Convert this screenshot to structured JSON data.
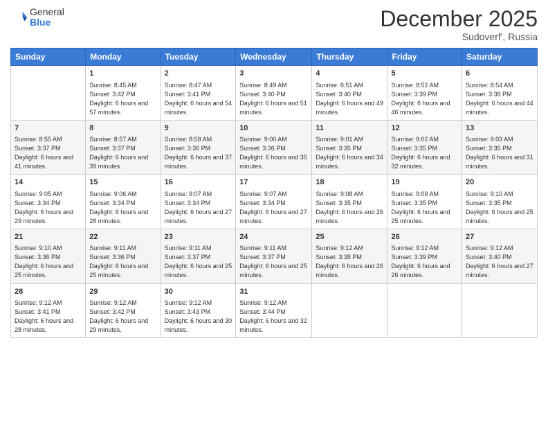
{
  "header": {
    "logo_general": "General",
    "logo_blue": "Blue",
    "month": "December 2025",
    "location": "Sudoverf', Russia"
  },
  "days_of_week": [
    "Sunday",
    "Monday",
    "Tuesday",
    "Wednesday",
    "Thursday",
    "Friday",
    "Saturday"
  ],
  "weeks": [
    [
      {
        "day": "",
        "empty": true
      },
      {
        "day": "1",
        "sunrise": "Sunrise: 8:45 AM",
        "sunset": "Sunset: 3:42 PM",
        "daylight": "Daylight: 6 hours and 57 minutes."
      },
      {
        "day": "2",
        "sunrise": "Sunrise: 8:47 AM",
        "sunset": "Sunset: 3:41 PM",
        "daylight": "Daylight: 6 hours and 54 minutes."
      },
      {
        "day": "3",
        "sunrise": "Sunrise: 8:49 AM",
        "sunset": "Sunset: 3:40 PM",
        "daylight": "Daylight: 6 hours and 51 minutes."
      },
      {
        "day": "4",
        "sunrise": "Sunrise: 8:51 AM",
        "sunset": "Sunset: 3:40 PM",
        "daylight": "Daylight: 6 hours and 49 minutes."
      },
      {
        "day": "5",
        "sunrise": "Sunrise: 8:52 AM",
        "sunset": "Sunset: 3:39 PM",
        "daylight": "Daylight: 6 hours and 46 minutes."
      },
      {
        "day": "6",
        "sunrise": "Sunrise: 8:54 AM",
        "sunset": "Sunset: 3:38 PM",
        "daylight": "Daylight: 6 hours and 44 minutes."
      }
    ],
    [
      {
        "day": "7",
        "sunrise": "Sunrise: 8:55 AM",
        "sunset": "Sunset: 3:37 PM",
        "daylight": "Daylight: 6 hours and 41 minutes."
      },
      {
        "day": "8",
        "sunrise": "Sunrise: 8:57 AM",
        "sunset": "Sunset: 3:37 PM",
        "daylight": "Daylight: 6 hours and 39 minutes."
      },
      {
        "day": "9",
        "sunrise": "Sunrise: 8:58 AM",
        "sunset": "Sunset: 3:36 PM",
        "daylight": "Daylight: 6 hours and 37 minutes."
      },
      {
        "day": "10",
        "sunrise": "Sunrise: 9:00 AM",
        "sunset": "Sunset: 3:36 PM",
        "daylight": "Daylight: 6 hours and 35 minutes."
      },
      {
        "day": "11",
        "sunrise": "Sunrise: 9:01 AM",
        "sunset": "Sunset: 3:35 PM",
        "daylight": "Daylight: 6 hours and 34 minutes."
      },
      {
        "day": "12",
        "sunrise": "Sunrise: 9:02 AM",
        "sunset": "Sunset: 3:35 PM",
        "daylight": "Daylight: 6 hours and 32 minutes."
      },
      {
        "day": "13",
        "sunrise": "Sunrise: 9:03 AM",
        "sunset": "Sunset: 3:35 PM",
        "daylight": "Daylight: 6 hours and 31 minutes."
      }
    ],
    [
      {
        "day": "14",
        "sunrise": "Sunrise: 9:05 AM",
        "sunset": "Sunset: 3:34 PM",
        "daylight": "Daylight: 6 hours and 29 minutes."
      },
      {
        "day": "15",
        "sunrise": "Sunrise: 9:06 AM",
        "sunset": "Sunset: 3:34 PM",
        "daylight": "Daylight: 6 hours and 28 minutes."
      },
      {
        "day": "16",
        "sunrise": "Sunrise: 9:07 AM",
        "sunset": "Sunset: 3:34 PM",
        "daylight": "Daylight: 6 hours and 27 minutes."
      },
      {
        "day": "17",
        "sunrise": "Sunrise: 9:07 AM",
        "sunset": "Sunset: 3:34 PM",
        "daylight": "Daylight: 6 hours and 27 minutes."
      },
      {
        "day": "18",
        "sunrise": "Sunrise: 9:08 AM",
        "sunset": "Sunset: 3:35 PM",
        "daylight": "Daylight: 6 hours and 26 minutes."
      },
      {
        "day": "19",
        "sunrise": "Sunrise: 9:09 AM",
        "sunset": "Sunset: 3:35 PM",
        "daylight": "Daylight: 6 hours and 25 minutes."
      },
      {
        "day": "20",
        "sunrise": "Sunrise: 9:10 AM",
        "sunset": "Sunset: 3:35 PM",
        "daylight": "Daylight: 6 hours and 25 minutes."
      }
    ],
    [
      {
        "day": "21",
        "sunrise": "Sunrise: 9:10 AM",
        "sunset": "Sunset: 3:36 PM",
        "daylight": "Daylight: 6 hours and 25 minutes."
      },
      {
        "day": "22",
        "sunrise": "Sunrise: 9:11 AM",
        "sunset": "Sunset: 3:36 PM",
        "daylight": "Daylight: 6 hours and 25 minutes."
      },
      {
        "day": "23",
        "sunrise": "Sunrise: 9:11 AM",
        "sunset": "Sunset: 3:37 PM",
        "daylight": "Daylight: 6 hours and 25 minutes."
      },
      {
        "day": "24",
        "sunrise": "Sunrise: 9:11 AM",
        "sunset": "Sunset: 3:37 PM",
        "daylight": "Daylight: 6 hours and 25 minutes."
      },
      {
        "day": "25",
        "sunrise": "Sunrise: 9:12 AM",
        "sunset": "Sunset: 3:38 PM",
        "daylight": "Daylight: 6 hours and 26 minutes."
      },
      {
        "day": "26",
        "sunrise": "Sunrise: 9:12 AM",
        "sunset": "Sunset: 3:39 PM",
        "daylight": "Daylight: 6 hours and 26 minutes."
      },
      {
        "day": "27",
        "sunrise": "Sunrise: 9:12 AM",
        "sunset": "Sunset: 3:40 PM",
        "daylight": "Daylight: 6 hours and 27 minutes."
      }
    ],
    [
      {
        "day": "28",
        "sunrise": "Sunrise: 9:12 AM",
        "sunset": "Sunset: 3:41 PM",
        "daylight": "Daylight: 6 hours and 28 minutes."
      },
      {
        "day": "29",
        "sunrise": "Sunrise: 9:12 AM",
        "sunset": "Sunset: 3:42 PM",
        "daylight": "Daylight: 6 hours and 29 minutes."
      },
      {
        "day": "30",
        "sunrise": "Sunrise: 9:12 AM",
        "sunset": "Sunset: 3:43 PM",
        "daylight": "Daylight: 6 hours and 30 minutes."
      },
      {
        "day": "31",
        "sunrise": "Sunrise: 9:12 AM",
        "sunset": "Sunset: 3:44 PM",
        "daylight": "Daylight: 6 hours and 32 minutes."
      },
      {
        "day": "",
        "empty": true
      },
      {
        "day": "",
        "empty": true
      },
      {
        "day": "",
        "empty": true
      }
    ]
  ]
}
